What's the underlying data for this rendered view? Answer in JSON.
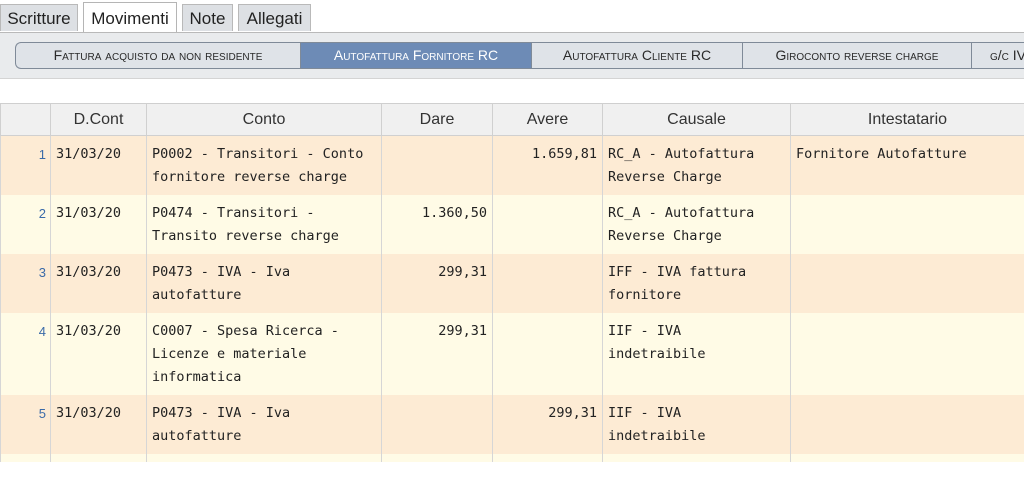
{
  "tabs": [
    {
      "label": "Scritture",
      "active": false
    },
    {
      "label": "Movimenti",
      "active": true
    },
    {
      "label": "Note",
      "active": false
    },
    {
      "label": "Allegati",
      "active": false
    }
  ],
  "subtabs": [
    {
      "label": "Fattura acquisto da non residente",
      "active": false
    },
    {
      "label": "Autofattura Fornitore RC",
      "active": true
    },
    {
      "label": "Autofattura Cliente RC",
      "active": false
    },
    {
      "label": "Giroconto reverse charge",
      "active": false
    },
    {
      "label": "g/c IV",
      "active": false
    }
  ],
  "table": {
    "headers": [
      "",
      "D.Cont",
      "Conto",
      "Dare",
      "Avere",
      "Causale",
      "Intestatario"
    ],
    "rows": [
      {
        "num": "1",
        "date": "31/03/20",
        "conto": "P0002 - Transitori - Conto fornitore reverse charge",
        "dare": "",
        "avere": "1.659,81",
        "causale": "RC_A - Autofattura Reverse Charge",
        "intestatario": "Fornitore Autofatture"
      },
      {
        "num": "2",
        "date": "31/03/20",
        "conto": "P0474 - Transitori - Transito reverse charge",
        "dare": "1.360,50",
        "avere": "",
        "causale": "RC_A - Autofattura Reverse Charge",
        "intestatario": ""
      },
      {
        "num": "3",
        "date": "31/03/20",
        "conto": "P0473 - IVA - Iva autofatture",
        "dare": "299,31",
        "avere": "",
        "causale": "IFF - IVA fattura fornitore",
        "intestatario": ""
      },
      {
        "num": "4",
        "date": "31/03/20",
        "conto": "C0007 - Spesa Ricerca - Licenze e materiale informatica",
        "dare": "299,31",
        "avere": "",
        "causale": "IIF - IVA indetraibile",
        "intestatario": ""
      },
      {
        "num": "5",
        "date": "31/03/20",
        "conto": "P0473 - IVA - Iva autofatture",
        "dare": "",
        "avere": "299,31",
        "causale": "IIF - IVA indetraibile",
        "intestatario": ""
      }
    ]
  }
}
